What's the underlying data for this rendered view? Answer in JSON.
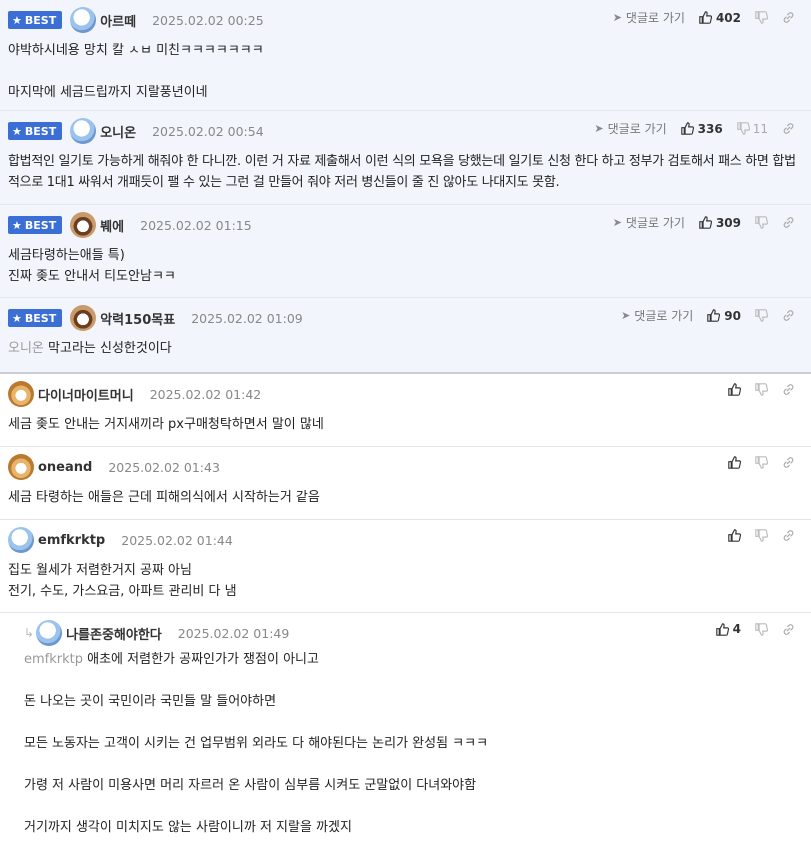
{
  "labels": {
    "best": "BEST",
    "goto": "댓글로 가기"
  },
  "comments": [
    {
      "nick": "아르떼",
      "date": "2025.02.02 00:25",
      "likes": "402",
      "dislikes": "",
      "lines": [
        "야박하시네용 망치 칼 ㅅㅂ 미친ㅋㅋㅋㅋㅋㅋㅋ",
        "",
        "마지막에 세금드립까지 지랄풍년이네"
      ]
    },
    {
      "nick": "오니온",
      "date": "2025.02.02 00:54",
      "likes": "336",
      "dislikes": "11",
      "lines": [
        "합법적인 일기토 가능하게 해줘야 한 다니깐. 이런 거 자료 제출해서 이런 식의 모욕을 당했는데 일기토 신청 한다 하고 정부가 검토해서 패스 하면 합법적으로 1대1 싸워서 개패듯이 팰 수 있는 그런 걸 만들어 줘야 저러 병신들이 줄 진 않아도 나대지도 못함."
      ]
    },
    {
      "nick": "붸에",
      "date": "2025.02.02 01:15",
      "likes": "309",
      "dislikes": "",
      "lines": [
        "세금타령하는애들 특)",
        "진짜 좆도 안내서 티도안남ㅋㅋ"
      ]
    },
    {
      "nick": "악력150목표",
      "date": "2025.02.02 01:09",
      "likes": "90",
      "dislikes": "",
      "mention": "오니온",
      "lines": [
        "막고라는 신성한것이다"
      ]
    },
    {
      "nick": "다이너마이트머니",
      "date": "2025.02.02 01:42",
      "likes": "",
      "dislikes": "",
      "lines": [
        "세금 좆도 안내는 거지새끼라 px구매청탁하면서 말이 많네"
      ]
    },
    {
      "nick": "oneand",
      "date": "2025.02.02 01:43",
      "likes": "",
      "dislikes": "",
      "lines": [
        "세금 타령하는 애들은 근데 피해의식에서 시작하는거 같음"
      ]
    },
    {
      "nick": "emfkrktp",
      "date": "2025.02.02 01:44",
      "likes": "",
      "dislikes": "",
      "lines": [
        "집도 월세가 저렴한거지 공짜 아님",
        "전기, 수도, 가스요금, 아파트 관리비 다 냄"
      ]
    },
    {
      "nick": "나를존중해야한다",
      "date": "2025.02.02 01:49",
      "likes": "4",
      "dislikes": "",
      "mention": "emfkrktp",
      "lines": [
        "애초에 저렴한가 공짜인가가 쟁점이 아니고",
        "",
        "돈 나오는 곳이 국민이라 국민들 말 들어야하면",
        "",
        "모든 노동자는 고객이 시키는 건 업무범위 외라도 다 해야된다는 논리가 완성됨 ㅋㅋㅋ",
        "",
        "가령 저 사람이 미용사면 머리 자르러 온 사람이 심부름 시켜도 군말없이 다녀와야함",
        "",
        "거기까지 생각이 미치지도 않는 사람이니까 저 지랄을 까겠지"
      ]
    }
  ],
  "colors": {
    "best_badge": "#3b6fd6",
    "best_bg": "#f2f5fb"
  },
  "icons": {
    "best": "star-icon",
    "goto": "send-arrow-icon",
    "like": "thumbs-up-icon",
    "dislike": "thumbs-down-icon",
    "link": "link-icon",
    "reply": "reply-arrow-icon"
  }
}
